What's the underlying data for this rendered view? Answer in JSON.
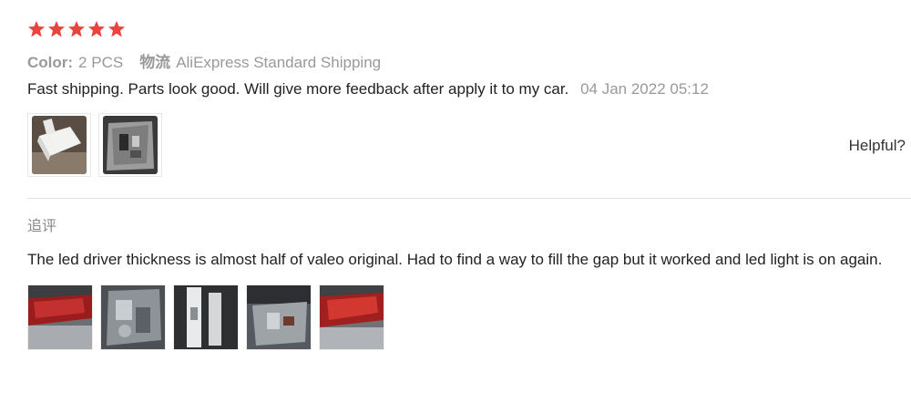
{
  "review": {
    "rating": 5,
    "color_label": "Color:",
    "color_value": "2 PCS",
    "shipping_label": "物流",
    "shipping_value": "AliExpress Standard Shipping",
    "text": "Fast shipping. Parts look good. Will give more feedback after apply it to my car.",
    "date": "04 Jan 2022 05:12",
    "photos": [
      "led-driver-photo",
      "led-board-foil-photo"
    ],
    "helpful_label": "Helpful?"
  },
  "followup": {
    "label": "追评",
    "text": "The led driver thickness is almost half of valeo original. Had to find a way to fill the gap but it worked and led light is on again.",
    "photos": [
      "tail-light-photo",
      "light-housing-photo",
      "driver-installed-photo",
      "housing-interior-photo",
      "tail-light-lit-photo"
    ]
  },
  "colors": {
    "star": "#e8453c",
    "muted_text": "#999999",
    "divider": "#e2e2e2"
  }
}
